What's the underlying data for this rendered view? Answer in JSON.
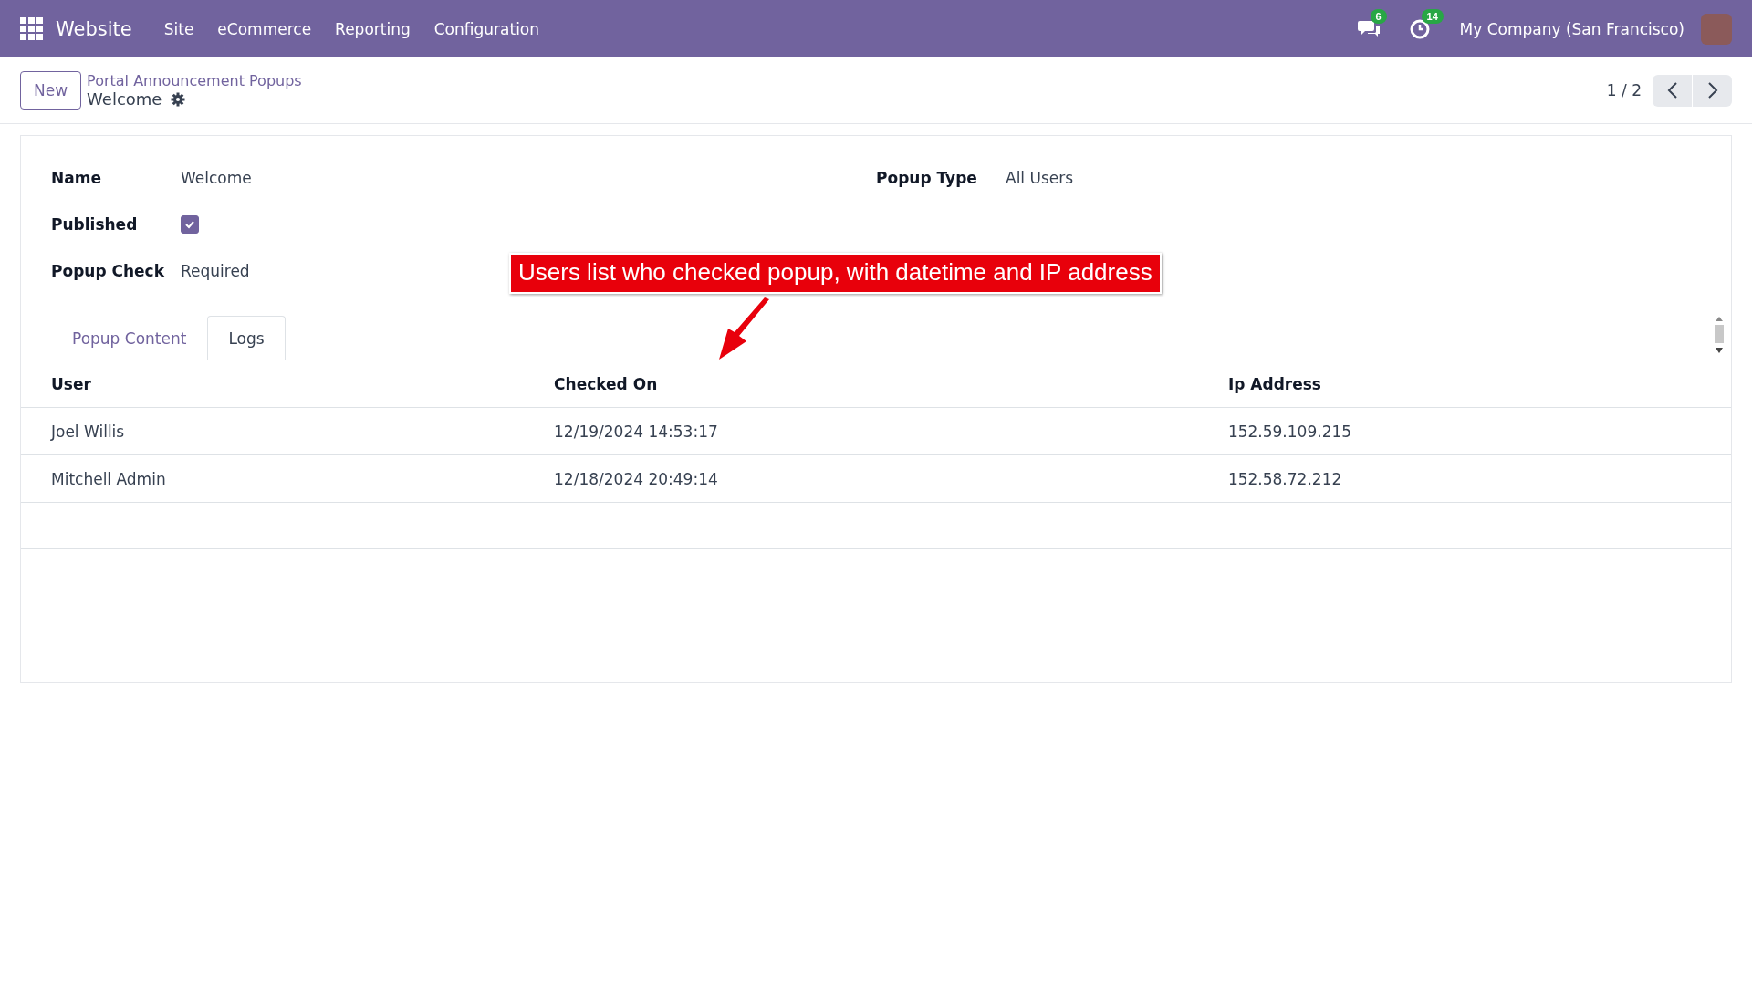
{
  "navbar": {
    "app_name": "Website",
    "menus": [
      "Site",
      "eCommerce",
      "Reporting",
      "Configuration"
    ],
    "messages_badge": "6",
    "activities_badge": "14",
    "company": "My Company (San Francisco)"
  },
  "control_panel": {
    "new_button": "New",
    "breadcrumb": "Portal Announcement Popups",
    "record_title": "Welcome",
    "pager": "1 / 2"
  },
  "form": {
    "left_fields": [
      {
        "kind": "text",
        "label": "Name",
        "value": "Welcome"
      },
      {
        "kind": "checkbox",
        "label": "Published",
        "checked": true
      },
      {
        "kind": "text",
        "label": "Popup Check",
        "value": "Required"
      }
    ],
    "right_fields": [
      {
        "kind": "text",
        "label": "Popup Type",
        "value": "All Users"
      }
    ],
    "tabs": [
      {
        "label": "Popup Content",
        "selected": false
      },
      {
        "label": "Logs",
        "selected": true
      }
    ],
    "table": {
      "columns": [
        "User",
        "Checked On",
        "Ip Address"
      ],
      "rows": [
        [
          "Joel Willis",
          "12/19/2024 14:53:17",
          "152.59.109.215"
        ],
        [
          "Mitchell Admin",
          "12/18/2024 20:49:14",
          "152.58.72.212"
        ]
      ]
    }
  },
  "annotation": {
    "text": "Users list who checked popup, with datetime and IP address"
  }
}
